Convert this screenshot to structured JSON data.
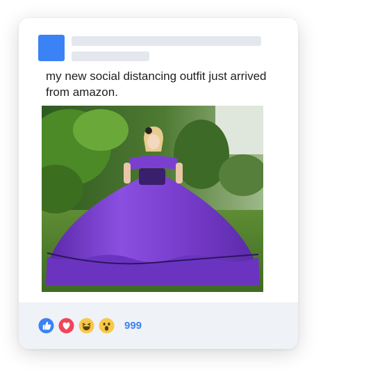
{
  "post": {
    "text": "my new social distancing outfit just arrived from amazon.",
    "image_subject": "woman in a large purple ball gown in a garden"
  },
  "reactions": {
    "icons": [
      "like-icon",
      "love-icon",
      "haha-icon",
      "wow-icon"
    ],
    "count": "999"
  },
  "colors": {
    "avatar": "#3b82f6",
    "placeholder": "#e4e7ee",
    "footer_bg": "#eff2f6",
    "count_text": "#3b82f6",
    "like": "#3b82f6",
    "love": "#f0455a",
    "emoji_yellow": "#f7c948",
    "dress_purple": "#7b3fd0"
  }
}
